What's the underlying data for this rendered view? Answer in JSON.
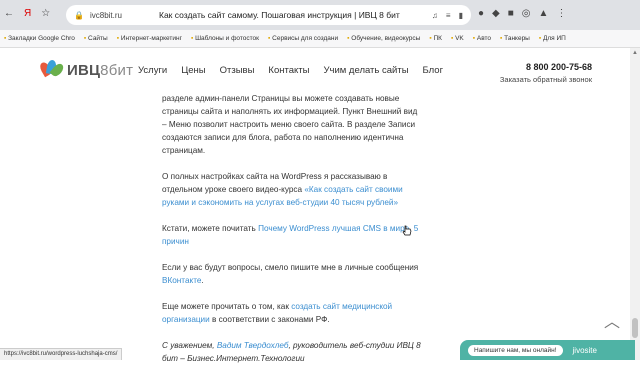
{
  "browser": {
    "back_icon": "back-icon",
    "url": "ivc8bit.ru",
    "tab_title": "Как создать сайт самому. Пошаговая инструкция | ИВЦ 8 бит"
  },
  "bookmarks": [
    "Закладки Google Chro",
    "Сайты",
    "Интернет-маркетинг",
    "Шаблоны и фотосток",
    "Сервисы для создани",
    "Обучение, видеокурсы",
    "ПК",
    "VK",
    "Авто",
    "Танкеры",
    "Для ИП"
  ],
  "header": {
    "logo_text": "ИВЦ",
    "logo_suffix": "8бит",
    "nav": [
      "Услуги",
      "Цены",
      "Отзывы",
      "Контакты",
      "Учим делать сайты",
      "Блог"
    ],
    "phone": "8 800 200-75-68",
    "callback": "Заказать обратный звонок"
  },
  "article": {
    "p1": "разделе админ-панели Страницы вы можете создавать новые страницы сайта и наполнять их информацией. Пункт Внешний вид – Меню позволит настроить меню своего сайта. В разделе Записи создаются записи для блога, работа по наполнению идентична страницам.",
    "p2_text": "О полных настройках сайта на WordPress я рассказываю в отдельном уроке своего видео-курса ",
    "p2_link": "«Как создать сайт своими руками и сэкономить на услугах веб-студии 40 тысяч рублей»",
    "p3_text": "Кстати, можете почитать ",
    "p3_link": "Почему WordPress лучшая CMS в мире. 5 причин",
    "p4_text": "Если у вас будут вопросы, смело пишите мне в личные сообщения ",
    "p4_link": "ВКонтакте",
    "p4_end": ".",
    "p5_text": "Еще можете прочитать о том, как ",
    "p5_link": "создать сайт медицинской организации",
    "p5_end": " в соответствии с законами РФ.",
    "p6_text": "С уважением, ",
    "p6_link": "Вадим Твердохлеб",
    "p6_end": ", руководитель веб-студии ИВЦ 8 бит – Бизнес.Интернет.Технологии"
  },
  "status_url": "https://ivc8bit.ru/wordpress-luchshaja-cms/",
  "chat": {
    "message": "Напишите нам, мы онлайн!",
    "brand": "jivosite"
  },
  "colors": {
    "link": "#3b8ed0",
    "chat": "#4fb3a5"
  }
}
